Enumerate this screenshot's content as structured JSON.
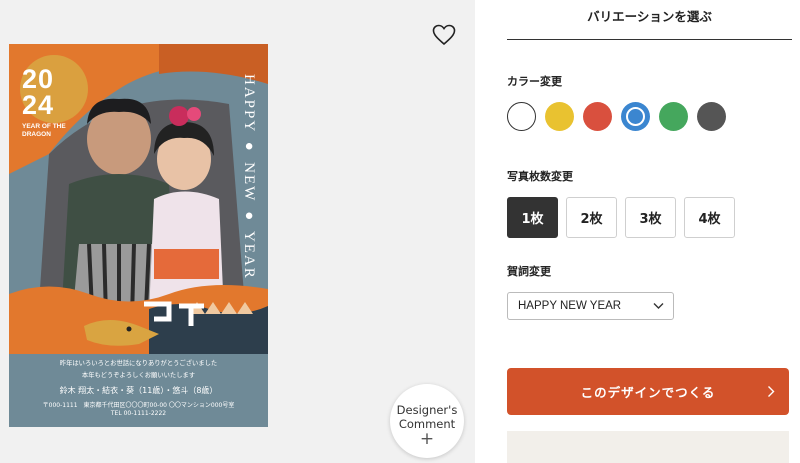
{
  "preview": {
    "favorite_icon": "heart-outline-icon",
    "card": {
      "year_top": "20",
      "year_bottom": "24",
      "year_subtitle": "YEAR OF THE DRAGON",
      "vertical_text": "HAPPY ● NEW ● YEAR",
      "greeting_line1": "昨年はいろいろとお世話になりありがとうございました",
      "greeting_line2": "本年もどうぞよろしくお願いいたします",
      "names": "鈴木 翔太・結衣・葵（11歳）・悠斗（8歳）",
      "address": "〒000-1111　東京都千代田区〇〇〇町00-00 〇〇マンション000号室",
      "tel": "TEL 00-1111-2222"
    },
    "designer_comment": {
      "line1": "Designer's",
      "line2": "Comment",
      "plus": "+"
    }
  },
  "options": {
    "title": "バリエーションを選ぶ",
    "color_label": "カラー変更",
    "colors": [
      "#ffffff",
      "#e9c230",
      "#d9503e",
      "#3b86d0",
      "#45a75d",
      "#555555"
    ],
    "selected_color_index": 3,
    "photo_count_label": "写真枚数変更",
    "photo_counts": [
      "1枚",
      "2枚",
      "3枚",
      "4枚"
    ],
    "selected_photo_count_index": 0,
    "greeting_label": "賀詞変更",
    "greeting_value": "HAPPY NEW YEAR",
    "cta_label": "このデザインでつくる"
  },
  "colors": {
    "accent": "#d2522a",
    "card_bg": "#6f8a97",
    "card_orange": "#e2782d"
  }
}
